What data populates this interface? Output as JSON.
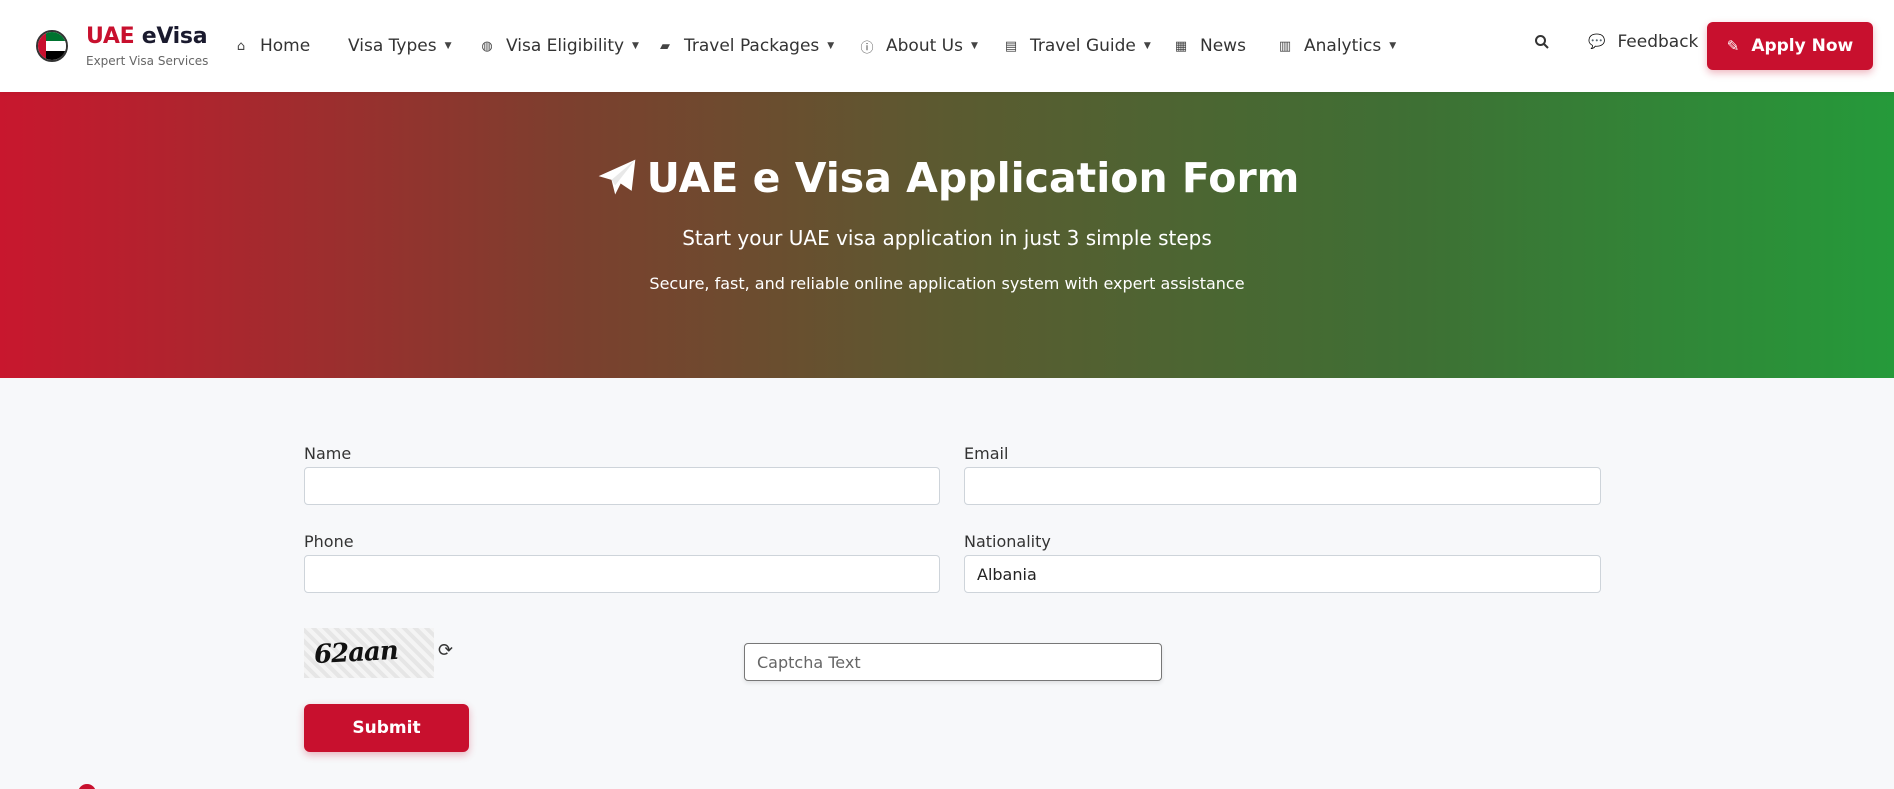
{
  "brand": {
    "title_part1": "UAE",
    "title_part2": "eVisa",
    "subtitle": "Expert Visa Services"
  },
  "nav": {
    "home": "Home",
    "visa_types": "Visa Types",
    "visa_eligibility": "Visa Eligibility",
    "travel_packages": "Travel Packages",
    "about_us": "About Us",
    "travel_guide": "Travel Guide",
    "news": "News",
    "analytics": "Analytics",
    "feedback": "Feedback",
    "apply_now": "Apply Now"
  },
  "hero": {
    "title": "UAE e Visa Application Form",
    "subtitle": "Start your UAE visa application in just 3 simple steps",
    "tagline": "Secure, fast, and reliable online application system with expert assistance"
  },
  "form": {
    "name_label": "Name",
    "name_value": "",
    "email_label": "Email",
    "email_value": "",
    "phone_label": "Phone",
    "phone_value": "",
    "nationality_label": "Nationality",
    "nationality_value": "Albania",
    "captcha_code": "62aan",
    "captcha_placeholder": "Captcha Text",
    "submit_label": "Submit"
  },
  "colors": {
    "brand_red": "#c8102e",
    "brand_green": "#259a3a"
  }
}
